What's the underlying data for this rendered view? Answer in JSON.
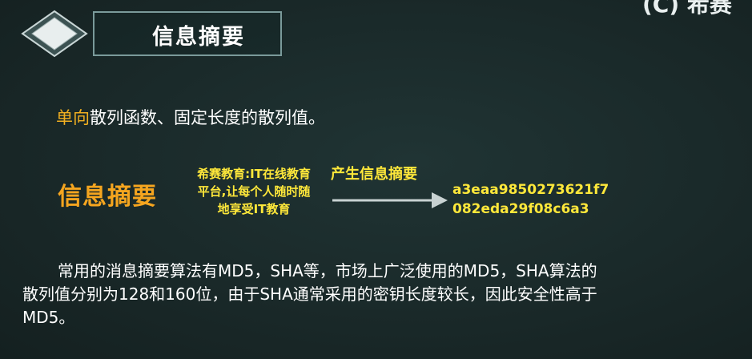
{
  "title": "信息摘要",
  "logo_text": "(C) 希赛",
  "definition": {
    "highlight": "单向",
    "rest": "散列函数、固定长度的散列值。"
  },
  "diagram": {
    "label": "信息摘要",
    "input_lines": [
      "希赛教育:IT在线教育",
      "平台,让每个人随时随",
      "地享受IT教育"
    ],
    "arrow_caption": "产生信息摘要",
    "hash_lines": [
      "a3eaa9850273621f7",
      "082eda29f08c6a3"
    ]
  },
  "paragraph": {
    "line1": "常用的消息摘要算法有MD5，SHA等，市场上广泛使用的MD5，SHA算法的",
    "line2": "散列值分别为128和160位，由于SHA通常采用的密钥长度较长，因此安全性高于",
    "line3": "MD5。"
  },
  "colors": {
    "background": "#1b2a2a",
    "highlight_orange": "#f2b021",
    "diagram_yellow": "#ffe83a",
    "label_orange": "#f5a51f"
  }
}
